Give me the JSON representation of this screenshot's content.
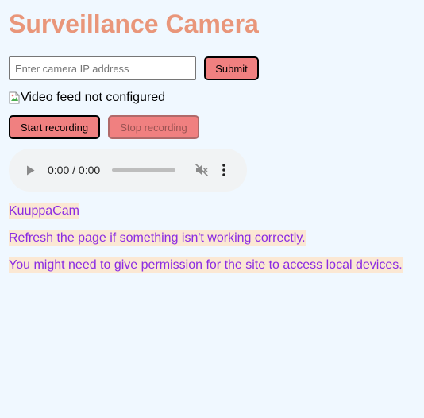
{
  "page": {
    "title": "Surveillance Camera",
    "colors": {
      "background": "#f0f8ff",
      "title": "#e9967a",
      "button": "#f08080",
      "note_text": "#8a2be2",
      "note_background": "#fbe8d4"
    }
  },
  "ip_form": {
    "placeholder": "Enter camera IP address",
    "value": "",
    "submit_label": "Submit"
  },
  "video": {
    "alt_text": "Video feed not configured",
    "icon": "broken-image-icon"
  },
  "recording": {
    "start_label": "Start recording",
    "stop_label": "Stop recording",
    "stop_enabled": false
  },
  "audio_player": {
    "time_display": "0:00 / 0:00",
    "progress": 0,
    "muted": true,
    "icons": [
      "play-icon",
      "mute-icon",
      "more-options-icon"
    ]
  },
  "notes": {
    "app_name": "KuuppaCam",
    "refresh_hint": "Refresh the page if something isn't working correctly.",
    "permission_hint": "You might need to give permission for the site to access local devices."
  }
}
